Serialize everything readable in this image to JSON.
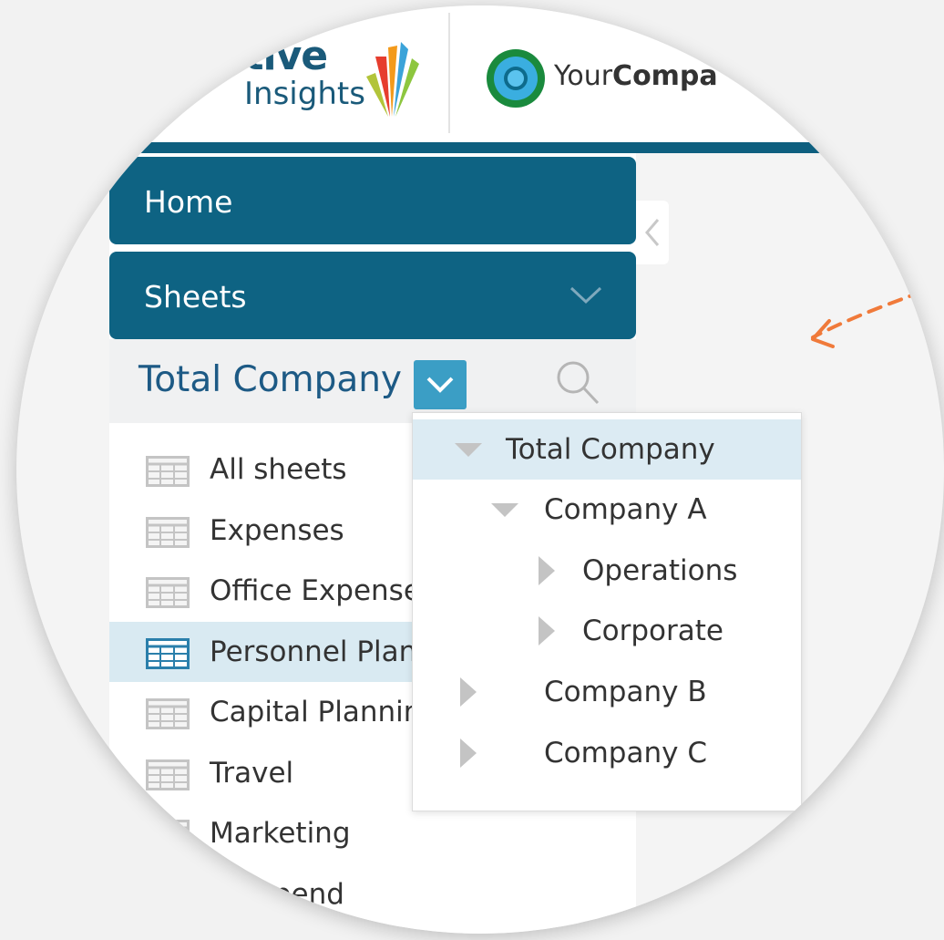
{
  "header": {
    "logo_primary_line1": "ptive",
    "logo_primary_line2": "Insights",
    "logo_company_prefix": "Your",
    "logo_company_bold": "Compa"
  },
  "nav": {
    "home_label": "Home",
    "sheets_label": "Sheets"
  },
  "filter": {
    "current_level": "Total Company"
  },
  "sheets": [
    {
      "label": "All sheets",
      "selected": false
    },
    {
      "label": "Expenses",
      "selected": false
    },
    {
      "label": "Office Expense",
      "selected": false
    },
    {
      "label": "Personnel Plan",
      "selected": true
    },
    {
      "label": "Capital Plannin",
      "selected": false
    },
    {
      "label": "Travel",
      "selected": false
    },
    {
      "label": "Marketing",
      "selected": false
    },
    {
      "label": "lor Spend",
      "selected": false
    }
  ],
  "dropdown": {
    "items": [
      {
        "label": "Total Company",
        "expanded": true,
        "highlighted": true
      },
      {
        "label": "Company A",
        "expanded": true,
        "highlighted": false
      },
      {
        "label": "Operations",
        "expanded": false,
        "highlighted": false
      },
      {
        "label": "Corporate",
        "expanded": false,
        "highlighted": false
      },
      {
        "label": "Company B",
        "expanded": false,
        "highlighted": false
      },
      {
        "label": "Company C",
        "expanded": false,
        "highlighted": false
      }
    ]
  },
  "colors": {
    "nav_blue": "#0e6383",
    "accent_blue": "#3b9ec5",
    "title_blue": "#1d5a85",
    "highlight": "#dcebf3",
    "arrow_orange": "#f07a3a"
  }
}
